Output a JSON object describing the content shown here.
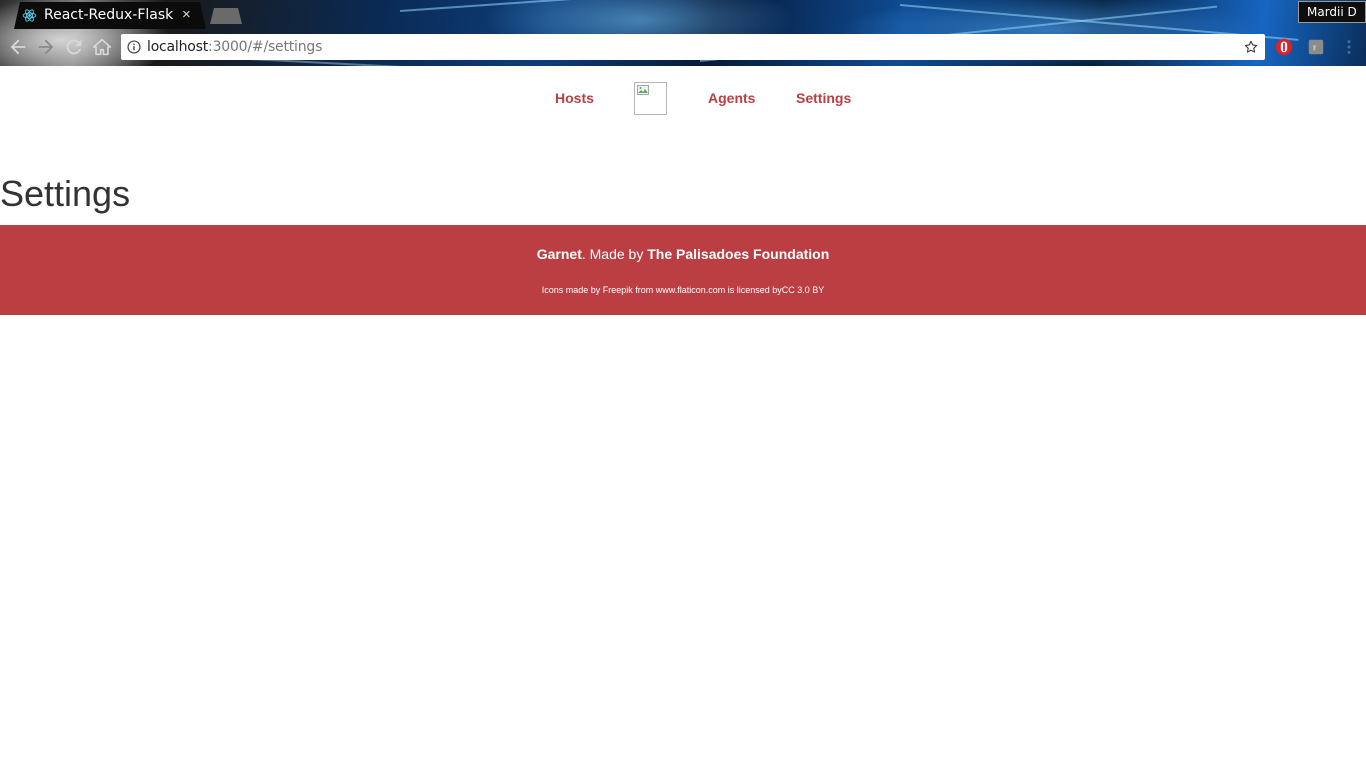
{
  "browser": {
    "tab_title": "React-Redux-Flask",
    "tab_close": "×",
    "profile_name": "Mardii D",
    "url_host": "localhost",
    "url_rest": ":3000/#/settings"
  },
  "nav": {
    "links": [
      "Hosts",
      "Agents",
      "Settings"
    ]
  },
  "page": {
    "title": "Settings"
  },
  "footer": {
    "brand": "Garnet",
    "made_by_text": ". Made by ",
    "organization": "The Palisadoes Foundation",
    "credit": "Icons made by Freepik from www.flaticon.com is licensed byCC 3.0 BY"
  },
  "colors": {
    "accent": "#bb3e42",
    "title_text": "#333333"
  }
}
